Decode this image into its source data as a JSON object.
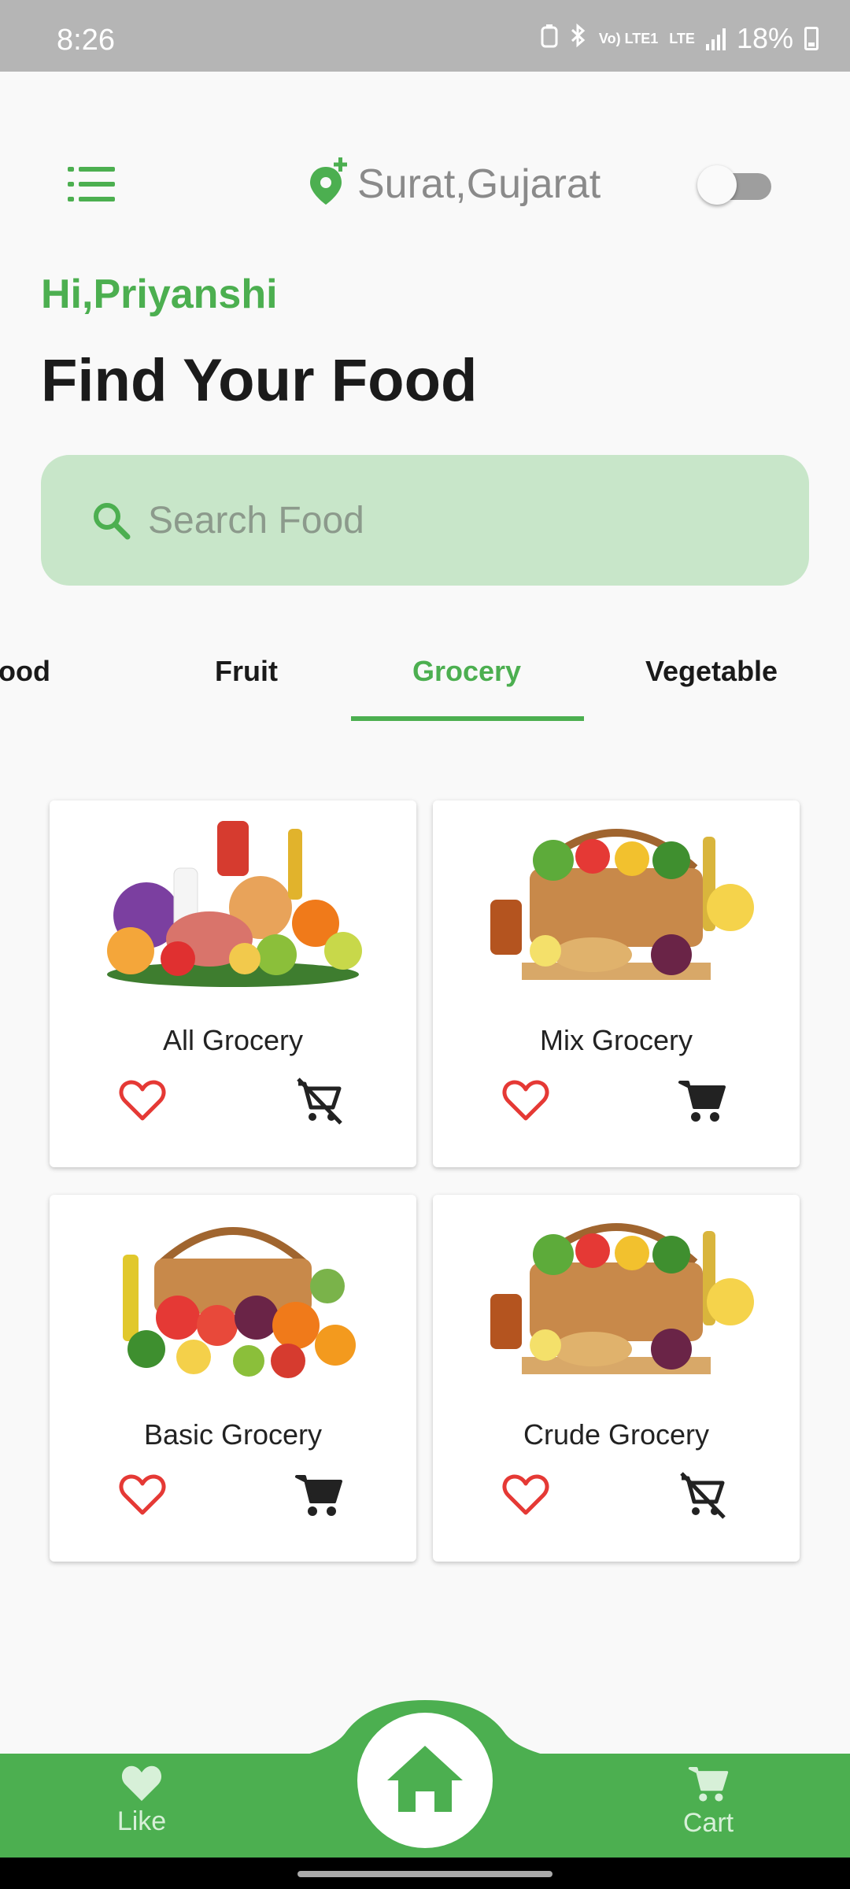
{
  "status_bar": {
    "time": "8:26",
    "network": "Vo) LTE1",
    "lte": "LTE",
    "battery": "18%"
  },
  "header": {
    "location": "Surat,Gujarat",
    "toggle_on": false
  },
  "greeting": "Hi,Priyanshi",
  "title": "Find Your Food",
  "search": {
    "placeholder": "Search Food",
    "value": ""
  },
  "tabs": [
    {
      "label": "Fast Food"
    },
    {
      "label": "Fruit"
    },
    {
      "label": "Grocery",
      "active": true
    },
    {
      "label": "Vegetable"
    }
  ],
  "products": [
    {
      "name": "All Grocery",
      "cart_available": false,
      "image": "grocery-assortment"
    },
    {
      "name": "Mix Grocery",
      "cart_available": true,
      "image": "grocery-basket"
    },
    {
      "name": "Basic Grocery",
      "cart_available": true,
      "image": "grocery-basket-fruits"
    },
    {
      "name": "Crude Grocery",
      "cart_available": false,
      "image": "grocery-basket"
    }
  ],
  "bottom_nav": {
    "like_label": "Like",
    "cart_label": "Cart"
  },
  "colors": {
    "accent": "#4caf50",
    "search_bg": "#c8e6c9",
    "heart": "#e53935"
  },
  "icons": [
    "menu-icon",
    "location-pin-icon",
    "search-icon",
    "heart-outline-icon",
    "cart-icon",
    "remove-cart-icon",
    "home-icon",
    "heart-icon"
  ]
}
